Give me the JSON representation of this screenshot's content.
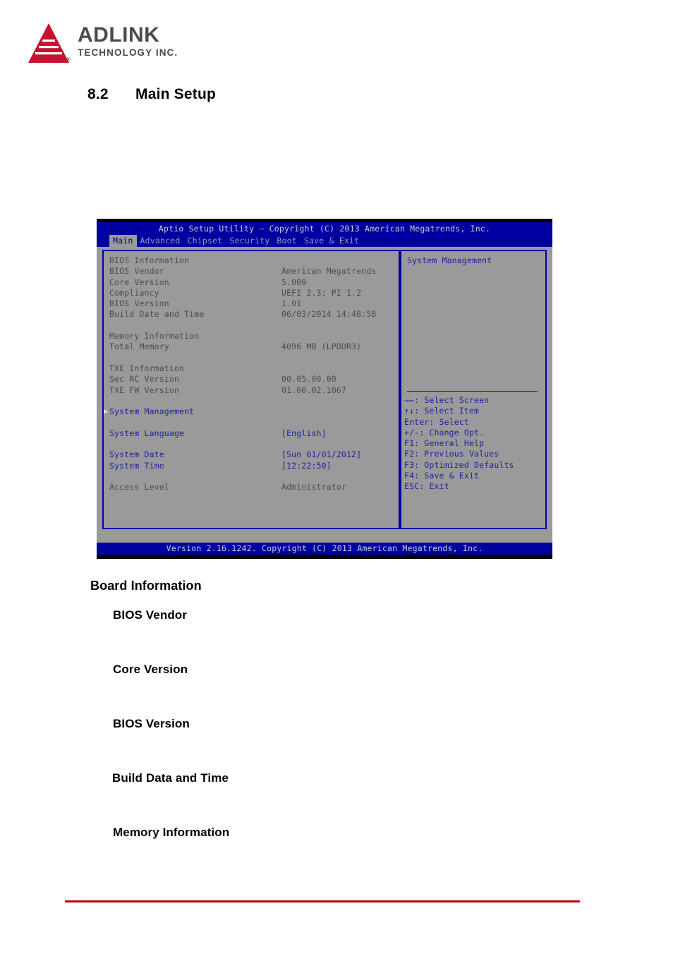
{
  "header": {
    "logo": {
      "mark": "adlink-triangle-logo",
      "wordmark": "ADLINK",
      "tagline": "TECHNOLOGY INC.",
      "registered_mark": "®",
      "mark_color": "#c8102e",
      "text_color": "#4b4b4f"
    }
  },
  "section": {
    "number": "8.2",
    "title": "Main Setup"
  },
  "bios": {
    "title": "Aptio Setup Utility – Copyright (C) 2013 American Megatrends, Inc.",
    "menu": [
      {
        "label": "Main",
        "active": true
      },
      {
        "label": "Advanced",
        "active": false
      },
      {
        "label": "Chipset",
        "active": false
      },
      {
        "label": "Security",
        "active": false
      },
      {
        "label": "Boot",
        "active": false
      },
      {
        "label": "Save & Exit",
        "active": false
      }
    ],
    "rows": [
      {
        "label": "BIOS Information",
        "value": "",
        "style": "dark"
      },
      {
        "label": "BIOS Vendor",
        "value": "American Megatrends",
        "style": "dark"
      },
      {
        "label": "Core Version",
        "value": "5.009",
        "style": "dark"
      },
      {
        "label": "Compliancy",
        "value": "UEFI 2.3; PI 1.2",
        "style": "dark"
      },
      {
        "label": "BIOS Version",
        "value": "1.01",
        "style": "dark"
      },
      {
        "label": "Build Date and Time",
        "value": "06/03/2014 14:48:58",
        "style": "dark"
      },
      {
        "label": "",
        "value": "",
        "style": "spacer"
      },
      {
        "label": "Memory Information",
        "value": "",
        "style": "dark"
      },
      {
        "label": "Total Memory",
        "value": "4096 MB (LPDDR3)",
        "style": "dark"
      },
      {
        "label": "",
        "value": "",
        "style": "spacer"
      },
      {
        "label": "TXE Information",
        "value": "",
        "style": "dark"
      },
      {
        "label": "Sec RC Version",
        "value": "00.05.00.00",
        "style": "dark"
      },
      {
        "label": "TXE FW Version",
        "value": "01.00.02.1067",
        "style": "dark"
      },
      {
        "label": "",
        "value": "",
        "style": "spacer"
      },
      {
        "label": "System Management",
        "value": "",
        "style": "blue",
        "submenu": true
      },
      {
        "label": "",
        "value": "",
        "style": "spacer"
      },
      {
        "label": "System Language",
        "value": "[English]",
        "style": "blue"
      },
      {
        "label": "",
        "value": "",
        "style": "spacer"
      },
      {
        "label": "System Date",
        "value": "[Sun 01/01/2012]",
        "style": "blue"
      },
      {
        "label": "System Time",
        "value": "[12:22:50]",
        "style": "blue"
      },
      {
        "label": "",
        "value": "",
        "style": "spacer"
      },
      {
        "label": "Access Level",
        "value": "Administrator",
        "style": "dark"
      }
    ],
    "help": {
      "title": "System Management",
      "keys": [
        "→←: Select Screen",
        "↑↓: Select Item",
        "Enter: Select",
        "+/-: Change Opt.",
        "F1: General Help",
        "F2: Previous Values",
        "F3: Optimized Defaults",
        "F4: Save & Exit",
        "ESC: Exit"
      ]
    },
    "footer": "Version 2.16.1242. Copyright (C) 2013 American Megatrends, Inc.",
    "colors": {
      "chrome_blue": "#0000a0",
      "panel_gray": "#9a9a9a",
      "text_blue": "#1f1f9e",
      "text_dark": "#4c4c4c"
    }
  },
  "body_text": {
    "heading": "Board Information",
    "items": [
      "BIOS Vendor",
      "Core Version",
      "BIOS Version",
      "Build Data and Time",
      "Memory Information"
    ]
  },
  "rule": {
    "color": "#c00014"
  }
}
